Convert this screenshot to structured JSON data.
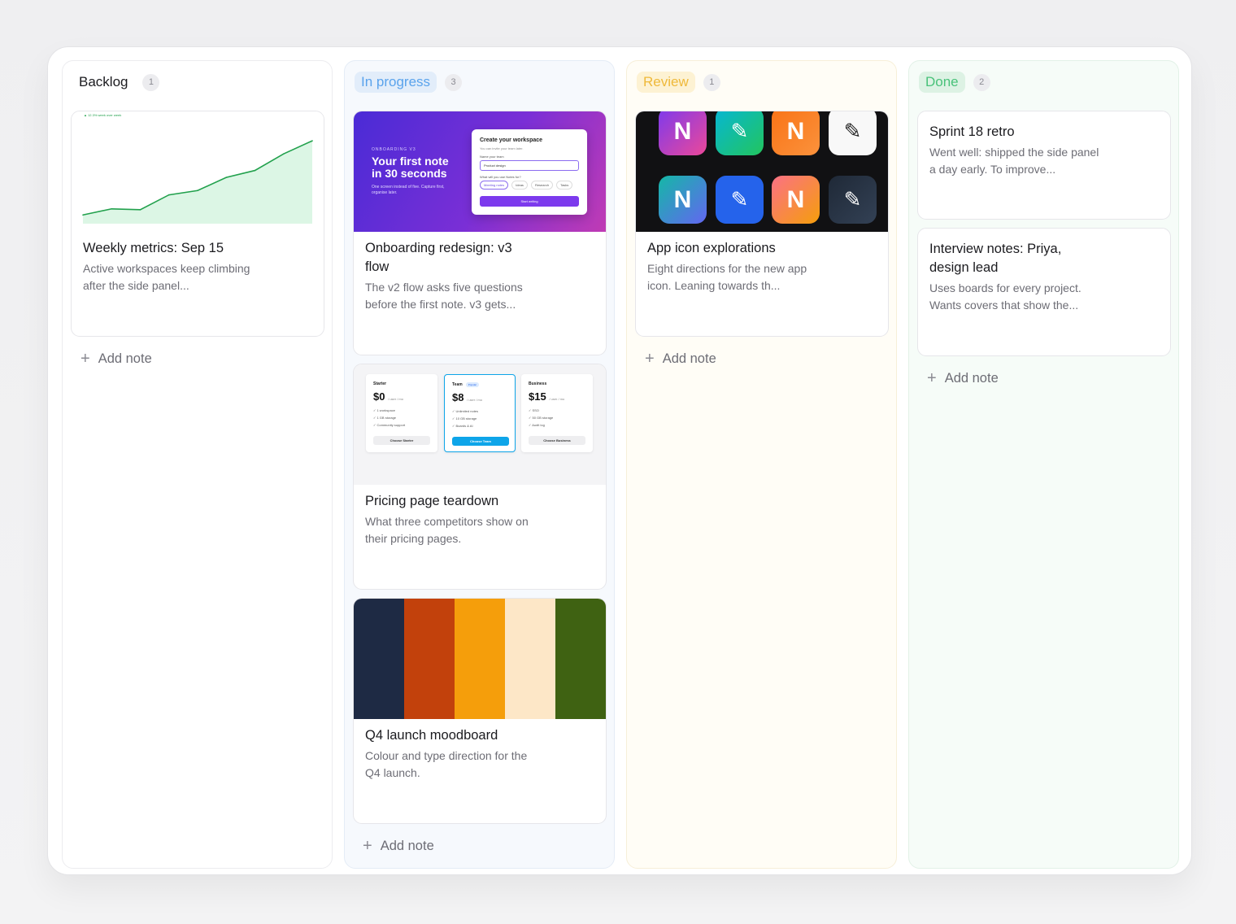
{
  "board": {
    "columns": [
      {
        "title": "Backlog",
        "count": "1",
        "add_label": "Add note",
        "cards": [
          {
            "title": "Weekly metrics: Sep 15",
            "desc": "Active workspaces keep climbing after the side panel...",
            "cover": {
              "kicker": "▲ 12.3% week over week"
            }
          }
        ]
      },
      {
        "title": "In progress",
        "count": "3",
        "add_label": "Add note",
        "cards": [
          {
            "title": "Onboarding redesign: v3 flow",
            "desc": "The v2 flow asks five questions before the first note. v3 gets...",
            "cover": {
              "kicker": "ONBOARDING V3",
              "headline": "Your first note in 30 seconds",
              "sub": "One screen instead of five. Capture first, organise later.",
              "modal_title": "Create your workspace",
              "modal_sub": "You can invite your team later.",
              "field_label": "Name your team",
              "field_value": "Product design",
              "question": "What will you use Notes for?",
              "chips": [
                "Meeting notes",
                "Ideas",
                "Research",
                "Tasks"
              ],
              "button": "Start writing"
            }
          },
          {
            "title": "Pricing page teardown",
            "desc": "What three competitors show on their pricing pages.",
            "cover": {
              "plans": [
                {
                  "name": "Starter",
                  "price": "$0",
                  "unit": "/ user / mo",
                  "features": [
                    "✓ 1 workspace",
                    "✓ 1 GB storage",
                    "✓ Community support"
                  ],
                  "button": "Choose Starter",
                  "badge": ""
                },
                {
                  "name": "Team",
                  "price": "$8",
                  "unit": "/ user / mo",
                  "features": [
                    "✓ Unlimited notes",
                    "✓ 10 GB storage",
                    "✓ Boards & AI"
                  ],
                  "button": "Choose Team",
                  "badge": "Popular"
                },
                {
                  "name": "Business",
                  "price": "$15",
                  "unit": "/ user / mo",
                  "features": [
                    "✓ SSO",
                    "✓ 50 GB storage",
                    "✓ Audit log"
                  ],
                  "button": "Choose Business",
                  "badge": ""
                }
              ]
            }
          },
          {
            "title": "Q4 launch moodboard",
            "desc": "Colour and type direction for the Q4 launch.",
            "cover": {
              "swatches": [
                "#1e2a44",
                "#c2410c",
                "#f59e0b",
                "#fde7c7",
                "#3f6212"
              ]
            }
          }
        ]
      },
      {
        "title": "Review",
        "count": "1",
        "add_label": "Add note",
        "cards": [
          {
            "title": "App icon explorations",
            "desc": "Eight directions for the new app icon. Leaning towards th...",
            "cover": {
              "icon_letter": "N",
              "icon_glyph": "✎"
            }
          }
        ]
      },
      {
        "title": "Done",
        "count": "2",
        "add_label": "Add note",
        "cards": [
          {
            "title": "Sprint 18 retro",
            "desc": "Went well: shipped the side panel a day early. To improve..."
          },
          {
            "title": "Interview notes: Priya, design lead",
            "desc": "Uses boards for every project. Wants covers that show the..."
          }
        ]
      }
    ]
  },
  "chart_data": {
    "type": "area",
    "x": [
      1,
      2,
      3,
      4,
      5,
      6,
      7,
      8,
      9
    ],
    "series": [
      {
        "values": [
          10,
          17,
          16,
          33,
          38,
          53,
          61,
          80,
          95
        ]
      }
    ],
    "ylim": [
      0,
      110
    ],
    "color": "#22a14d",
    "fill": "#dcf6e5",
    "grid": false
  }
}
